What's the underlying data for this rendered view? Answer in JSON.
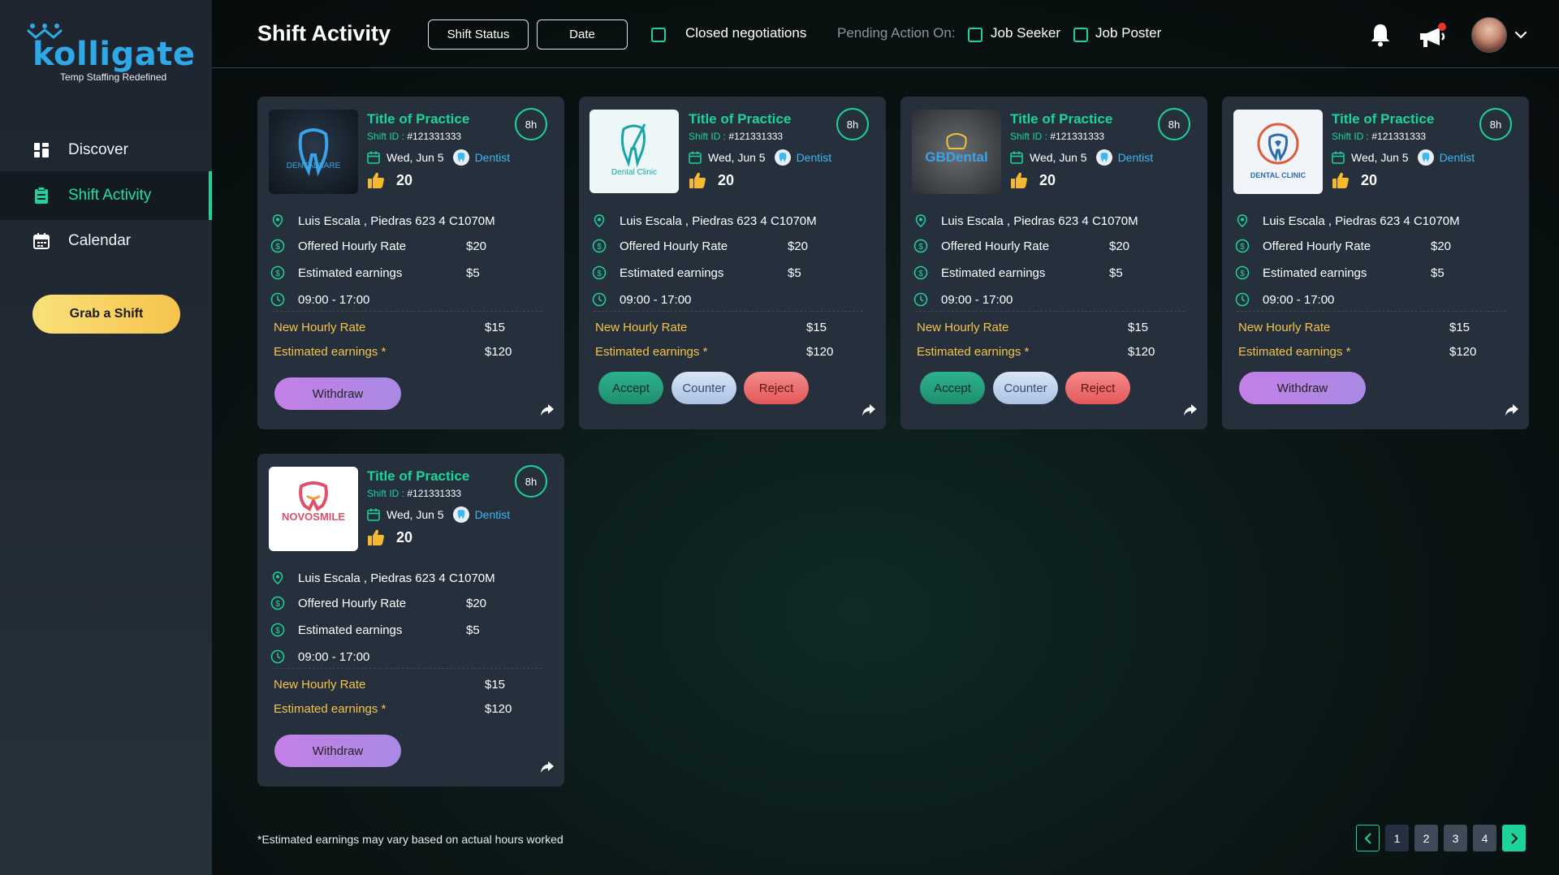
{
  "brand": {
    "name": "kolligate",
    "tagline": "Temp Staffing Redefined"
  },
  "sidebar": {
    "items": [
      {
        "label": "Discover",
        "icon": "grid-icon"
      },
      {
        "label": "Shift Activity",
        "icon": "clipboard-icon"
      },
      {
        "label": "Calendar",
        "icon": "calendar-icon"
      }
    ],
    "cta": "Grab a Shift"
  },
  "header": {
    "title": "Shift Activity",
    "filter_status": "Shift Status",
    "filter_date": "Date",
    "closed_negotiations": "Closed negotiations",
    "pending_label": "Pending Action On:",
    "job_seeker": "Job Seeker",
    "job_poster": "Job Poster"
  },
  "cards": [
    {
      "logo_text": "DENTALCARE",
      "title": "Title of Practice",
      "shift_id_label": "Shift ID :",
      "shift_id": "#121331333",
      "date": "Wed, Jun 5",
      "role": "Dentist",
      "likes": "20",
      "hours": "8h",
      "address": "Luis Escala , Piedras 623 4 C1070M",
      "offered_label": "Offered Hourly Rate",
      "offered_value": "$20",
      "est_label": "Estimated earnings",
      "est_value": "$5",
      "time": "09:00 - 17:00",
      "new_rate_label": "New Hourly Rate",
      "new_rate_value": "$15",
      "new_est_label": "Estimated earnings *",
      "new_est_value": "$120",
      "actions": [
        "Withdraw"
      ]
    },
    {
      "logo_text": "Dental Clinic",
      "title": "Title of Practice",
      "shift_id_label": "Shift ID :",
      "shift_id": "#121331333",
      "date": "Wed, Jun 5",
      "role": "Dentist",
      "likes": "20",
      "hours": "8h",
      "address": "Luis Escala , Piedras 623 4 C1070M",
      "offered_label": "Offered Hourly Rate",
      "offered_value": "$20",
      "est_label": "Estimated earnings",
      "est_value": "$5",
      "time": "09:00 - 17:00",
      "new_rate_label": "New Hourly Rate",
      "new_rate_value": "$15",
      "new_est_label": "Estimated earnings *",
      "new_est_value": "$120",
      "actions": [
        "Accept",
        "Counter",
        "Reject"
      ]
    },
    {
      "logo_text": "GBDental",
      "title": "Title of Practice",
      "shift_id_label": "Shift ID :",
      "shift_id": "#121331333",
      "date": "Wed, Jun 5",
      "role": "Dentist",
      "likes": "20",
      "hours": "8h",
      "address": "Luis Escala , Piedras 623 4 C1070M",
      "offered_label": "Offered Hourly Rate",
      "offered_value": "$20",
      "est_label": "Estimated earnings",
      "est_value": "$5",
      "time": "09:00 - 17:00",
      "new_rate_label": "New Hourly Rate",
      "new_rate_value": "$15",
      "new_est_label": "Estimated earnings *",
      "new_est_value": "$120",
      "actions": [
        "Accept",
        "Counter",
        "Reject"
      ]
    },
    {
      "logo_text": "DENTAL CLINIC",
      "title": "Title of Practice",
      "shift_id_label": "Shift ID :",
      "shift_id": "#121331333",
      "date": "Wed, Jun 5",
      "role": "Dentist",
      "likes": "20",
      "hours": "8h",
      "address": "Luis Escala , Piedras 623 4 C1070M",
      "offered_label": "Offered Hourly Rate",
      "offered_value": "$20",
      "est_label": "Estimated earnings",
      "est_value": "$5",
      "time": "09:00 - 17:00",
      "new_rate_label": "New Hourly Rate",
      "new_rate_value": "$15",
      "new_est_label": "Estimated earnings *",
      "new_est_value": "$120",
      "actions": [
        "Withdraw"
      ]
    },
    {
      "logo_text": "NOVOSMILE",
      "title": "Title of Practice",
      "shift_id_label": "Shift ID :",
      "shift_id": "#121331333",
      "date": "Wed, Jun 5",
      "role": "Dentist",
      "likes": "20",
      "hours": "8h",
      "address": "Luis Escala , Piedras 623 4 C1070M",
      "offered_label": "Offered Hourly Rate",
      "offered_value": "$20",
      "est_label": "Estimated earnings",
      "est_value": "$5",
      "time": "09:00 - 17:00",
      "new_rate_label": "New Hourly Rate",
      "new_rate_value": "$15",
      "new_est_label": "Estimated earnings *",
      "new_est_value": "$120",
      "actions": [
        "Withdraw"
      ]
    }
  ],
  "footnote": "*Estimated earnings may vary based on actual hours worked",
  "pagination": {
    "pages": [
      "1",
      "2",
      "3",
      "4"
    ],
    "current": "1"
  },
  "colors": {
    "accent": "#1ed39a",
    "gold": "#f5c34e",
    "role_blue": "#3fb6ee",
    "card_bg": "#26303c"
  }
}
